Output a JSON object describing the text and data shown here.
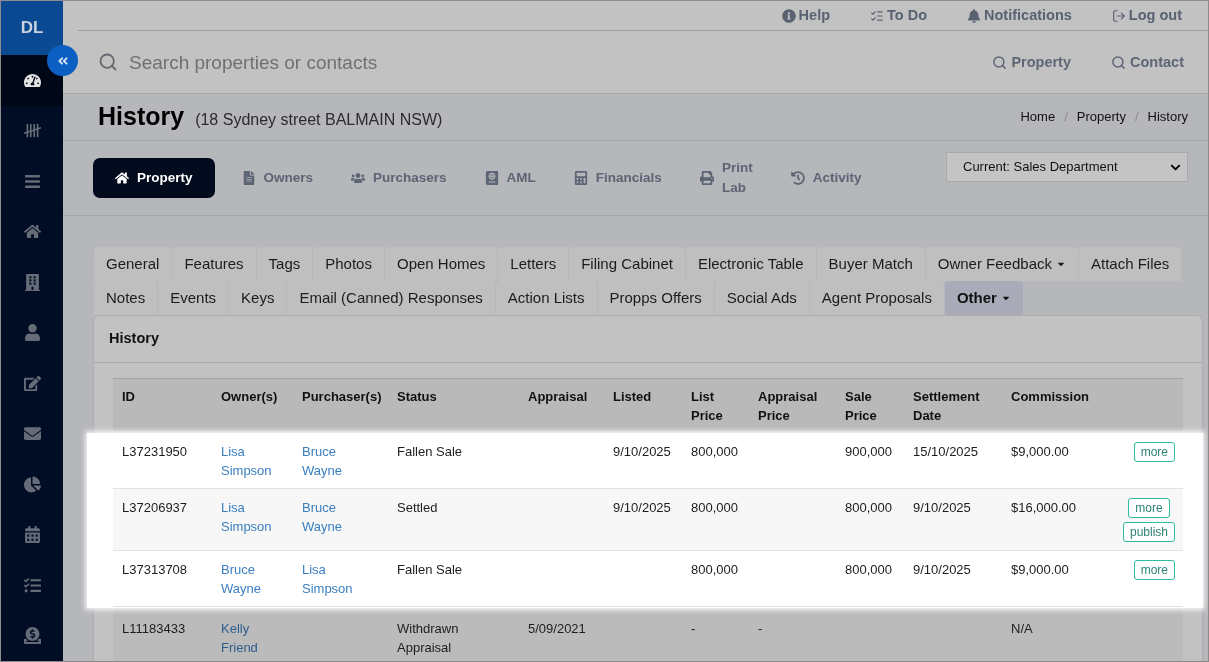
{
  "sidebar": {
    "logo": "DL",
    "items": [
      {
        "selected": true
      },
      {
        "selected": false
      },
      {
        "selected": false
      },
      {
        "selected": false
      },
      {
        "selected": false
      },
      {
        "selected": false
      },
      {
        "selected": false
      },
      {
        "selected": false
      },
      {
        "selected": false
      },
      {
        "selected": false
      },
      {
        "selected": false
      },
      {
        "selected": false
      }
    ]
  },
  "top_bar": {
    "links": [
      "Help",
      "To Do",
      "Notifications",
      "Log out"
    ]
  },
  "search": {
    "placeholder": "Search properties or contacts",
    "scopes": [
      "Property",
      "Contact"
    ]
  },
  "page_header": {
    "title": "History",
    "subtitle": "(18 Sydney street BALMAIN NSW)",
    "breadcrumb": {
      "items": [
        "Home",
        "Property",
        "History"
      ],
      "separators": [
        "/",
        "/"
      ]
    }
  },
  "property_tabs": [
    {
      "label": "Property",
      "selected": true
    },
    {
      "label": "Owners",
      "selected": false
    },
    {
      "label": "Purchasers",
      "selected": false
    },
    {
      "label": "AML",
      "selected": false
    },
    {
      "label": "Financials",
      "selected": false
    },
    {
      "label": "Print Lab",
      "selected": false
    },
    {
      "label": "Activity",
      "selected": false
    }
  ],
  "department_select": {
    "value": "Current: Sales Department"
  },
  "section_tabs": [
    [
      {
        "label": "General",
        "selected": false,
        "dropdown": false
      },
      {
        "label": "Features",
        "selected": false,
        "dropdown": false
      },
      {
        "label": "Tags",
        "selected": false,
        "dropdown": false
      },
      {
        "label": "Photos",
        "selected": false,
        "dropdown": false
      },
      {
        "label": "Open Homes",
        "selected": false,
        "dropdown": false
      },
      {
        "label": "Letters",
        "selected": false,
        "dropdown": false
      },
      {
        "label": "Filing Cabinet",
        "selected": false,
        "dropdown": false
      },
      {
        "label": "Electronic Table",
        "selected": false,
        "dropdown": false
      },
      {
        "label": "Buyer Match",
        "selected": false,
        "dropdown": false
      },
      {
        "label": "Owner Feedback",
        "selected": false,
        "dropdown": true
      },
      {
        "label": "Attach Files",
        "selected": false,
        "dropdown": false
      }
    ],
    [
      {
        "label": "Notes",
        "selected": false,
        "dropdown": false
      },
      {
        "label": "Events",
        "selected": false,
        "dropdown": false
      },
      {
        "label": "Keys",
        "selected": false,
        "dropdown": false
      },
      {
        "label": "Email (Canned) Responses",
        "selected": false,
        "dropdown": false
      },
      {
        "label": "Action Lists",
        "selected": false,
        "dropdown": false
      },
      {
        "label": "Propps Offers",
        "selected": false,
        "dropdown": false
      },
      {
        "label": "Social Ads",
        "selected": false,
        "dropdown": false
      },
      {
        "label": "Agent Proposals",
        "selected": false,
        "dropdown": false
      },
      {
        "label": "Other",
        "selected": true,
        "dropdown": true
      }
    ]
  ],
  "panel": {
    "title": "History"
  },
  "table": {
    "columns": [
      "ID",
      "Owner(s)",
      "Purchaser(s)",
      "Status",
      "Appraisal",
      "Listed",
      "List Price",
      "Appraisal Price",
      "Sale Price",
      "Settlement Date",
      "Commission"
    ],
    "rows": [
      {
        "highlighted": true,
        "id": "L37231950",
        "owners": "Lisa Simpson",
        "purchasers": "Bruce Wayne",
        "status": "Fallen Sale",
        "listed": "9/10/2025",
        "list_price": "800,000",
        "sale_price": "900,000",
        "settlement_date": "15/10/2025",
        "commission": "$9,000.00",
        "actions": [
          "more"
        ]
      },
      {
        "highlighted": true,
        "id": "L37206937",
        "owners": "Lisa Simpson",
        "purchasers": "Bruce Wayne",
        "status": "Settled",
        "listed": "9/10/2025",
        "list_price": "800,000",
        "sale_price": "800,000",
        "settlement_date": "9/10/2025",
        "commission": "$16,000.00",
        "actions": [
          "more",
          "publish"
        ]
      },
      {
        "highlighted": true,
        "id": "L37313708",
        "owners": "Bruce Wayne",
        "purchasers": "Lisa Simpson",
        "status": "Fallen Sale",
        "list_price": "800,000",
        "sale_price": "800,000",
        "settlement_date": "9/10/2025",
        "commission": "$9,000.00",
        "actions": [
          "more"
        ]
      },
      {
        "highlighted": false,
        "id": "L11183433",
        "owners": "Kelly Friend",
        "status": "Withdrawn Appraisal",
        "appraisal": "5/09/2021",
        "list_price": "-",
        "appraisal_price": "-",
        "commission": "N/A"
      }
    ]
  }
}
